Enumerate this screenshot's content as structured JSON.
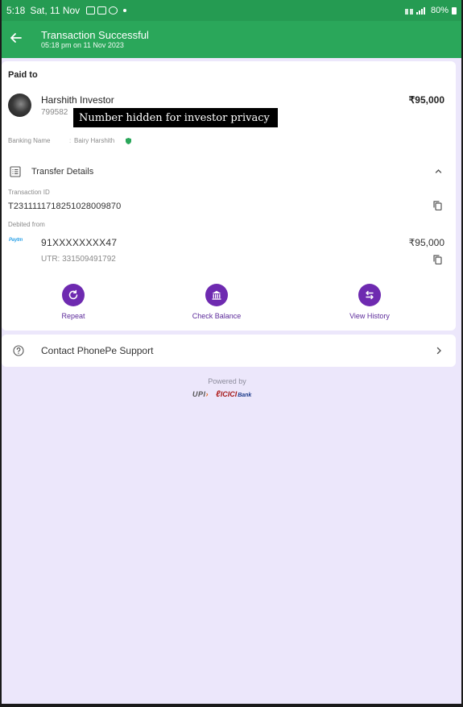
{
  "status_bar": {
    "time": "5:18",
    "date": "Sat, 11 Nov",
    "battery": "80%"
  },
  "header": {
    "title": "Transaction Successful",
    "subtitle": "05:18 pm on 11 Nov 2023",
    "bg_color": "#2aa75a"
  },
  "payee": {
    "section_label": "Paid to",
    "name": "Harshith Investor",
    "number_partial": "799582",
    "redaction_note": "Number hidden for investor privacy",
    "amount": "₹95,000",
    "banking_name_label": "Banking Name",
    "banking_name_value": "Bairy Harshith"
  },
  "transfer_details": {
    "title": "Transfer Details",
    "transaction_id_label": "Transaction ID",
    "transaction_id": "T2311111718251028009870",
    "debited_from_label": "Debited from",
    "account_logo": "Paytm",
    "account_number": "91XXXXXXXX47",
    "account_amount": "₹95,000",
    "utr": "UTR: 331509491792"
  },
  "actions": [
    {
      "label": "Repeat",
      "icon": "repeat-icon"
    },
    {
      "label": "Check Balance",
      "icon": "bank-icon"
    },
    {
      "label": "View History",
      "icon": "swap-icon"
    }
  ],
  "support": {
    "label": "Contact PhonePe Support"
  },
  "footer": {
    "powered_by": "Powered by",
    "upi_logo": "UPI",
    "bank_logo": "ICICI",
    "bank_logo_suffix": "Bank"
  },
  "colors": {
    "accent_purple": "#6e2ab0",
    "header_green": "#2aa75a",
    "page_bg": "#ece7fb"
  }
}
